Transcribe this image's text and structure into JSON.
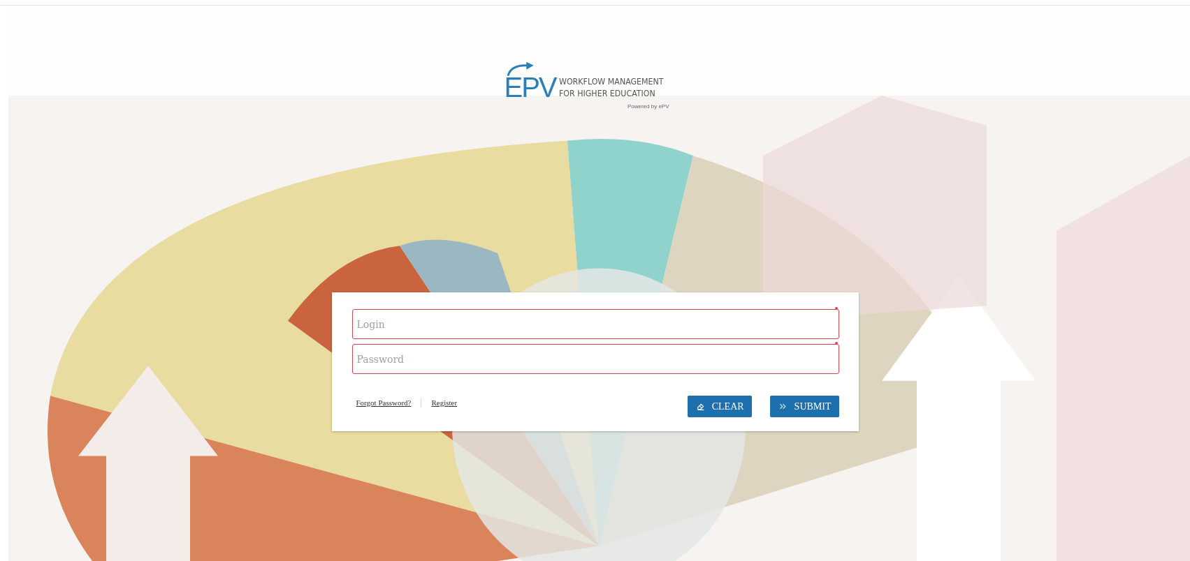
{
  "logo": {
    "mark": "EPV",
    "line_1": "WORKFLOW MANAGEMENT",
    "line_2": "FOR HIGHER EDUCATION",
    "powered_by": "Powered by ePV"
  },
  "form": {
    "fields": [
      {
        "placeholder": "Login",
        "required": true
      },
      {
        "placeholder": "Password",
        "required": true
      }
    ],
    "links": [
      "Forgot Password?",
      "Register"
    ],
    "buttons": [
      {
        "label": "CLEAR",
        "kind": "clear"
      },
      {
        "label": "SUBMIT",
        "kind": "submit"
      }
    ]
  }
}
